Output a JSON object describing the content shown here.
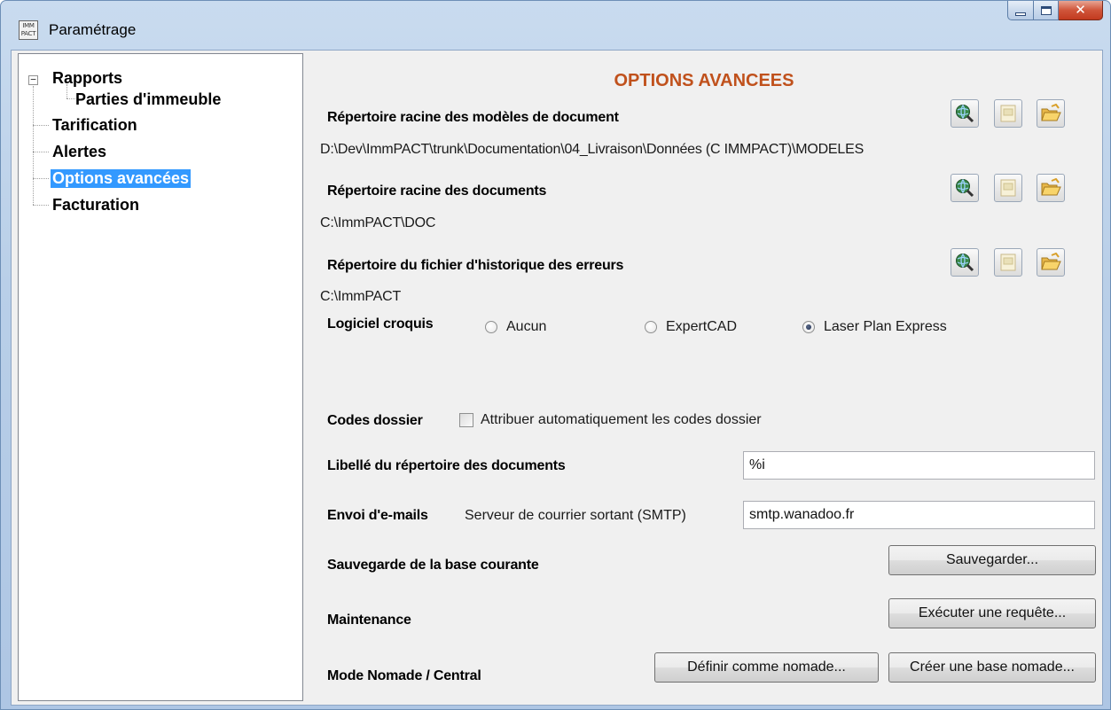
{
  "window": {
    "title": "Paramétrage",
    "app_icon_text": "IMM\nPACT"
  },
  "tree": {
    "items": [
      {
        "label": "Rapports"
      },
      {
        "label": "Parties d'immeuble"
      },
      {
        "label": "Tarification"
      },
      {
        "label": "Alertes"
      },
      {
        "label": "Options avancées",
        "selected": true
      },
      {
        "label": "Facturation"
      }
    ]
  },
  "options": {
    "title": "OPTIONS AVANCEES",
    "rep_modeles_label": "Répertoire racine des modèles de document",
    "rep_modeles_path": "D:\\Dev\\ImmPACT\\trunk\\Documentation\\04_Livraison\\Données (C IMMPACT)\\MODELES",
    "rep_documents_label": "Répertoire racine des documents",
    "rep_documents_path": "C:\\ImmPACT\\DOC",
    "rep_historique_label": "Répertoire du fichier d'historique des erreurs",
    "rep_historique_path": "C:\\ImmPACT",
    "logiciel_label": "Logiciel croquis",
    "logiciel_options": [
      "Aucun",
      "ExpertCAD",
      "Laser Plan Express"
    ],
    "logiciel_selected": "Laser Plan Express",
    "codes_label": "Codes dossier",
    "codes_checkbox": "Attribuer automatiquement les codes dossier",
    "codes_checked": false,
    "libelle_label": "Libellé du répertoire des documents",
    "libelle_value": "%i",
    "envoi_label": "Envoi d'e-mails",
    "smtp_label": "Serveur de courrier sortant (SMTP)",
    "smtp_value": "smtp.wanadoo.fr",
    "sauvegarde_label": "Sauvegarde de la base courante",
    "sauvegarde_button": "Sauvegarder...",
    "maintenance_label": "Maintenance",
    "maintenance_button": "Exécuter une requête...",
    "mode_label": "Mode Nomade / Central",
    "mode_button_1": "Définir comme nomade...",
    "mode_button_2": "Créer une base nomade..."
  },
  "icons": {
    "browse": "globe-search-icon",
    "view": "document-view-icon",
    "open": "folder-open-icon"
  },
  "colors": {
    "title_accent": "#c0511c",
    "selection": "#3399ff"
  }
}
